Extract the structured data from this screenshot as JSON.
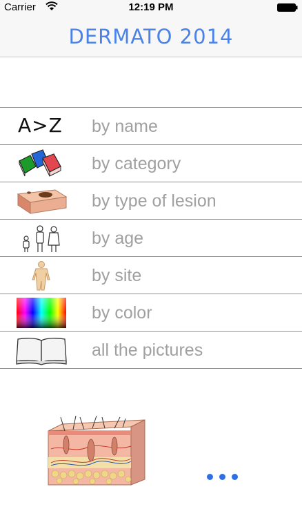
{
  "status": {
    "carrier": "Carrier",
    "time": "12:19 PM"
  },
  "app": {
    "title": "DERMATO 2014"
  },
  "menu": [
    {
      "label": "by name",
      "icon": "a-to-z-icon",
      "icon_text": "A>Z"
    },
    {
      "label": "by category",
      "icon": "books-icon"
    },
    {
      "label": "by type of lesion",
      "icon": "lesion-icon"
    },
    {
      "label": "by age",
      "icon": "family-icon"
    },
    {
      "label": "by site",
      "icon": "body-icon"
    },
    {
      "label": "by color",
      "icon": "color-spectrum-icon"
    },
    {
      "label": "all the pictures",
      "icon": "open-book-icon"
    }
  ],
  "colors": {
    "title": "#4a82e8",
    "label": "#a0a0a0",
    "dots": "#2f6fe6"
  }
}
